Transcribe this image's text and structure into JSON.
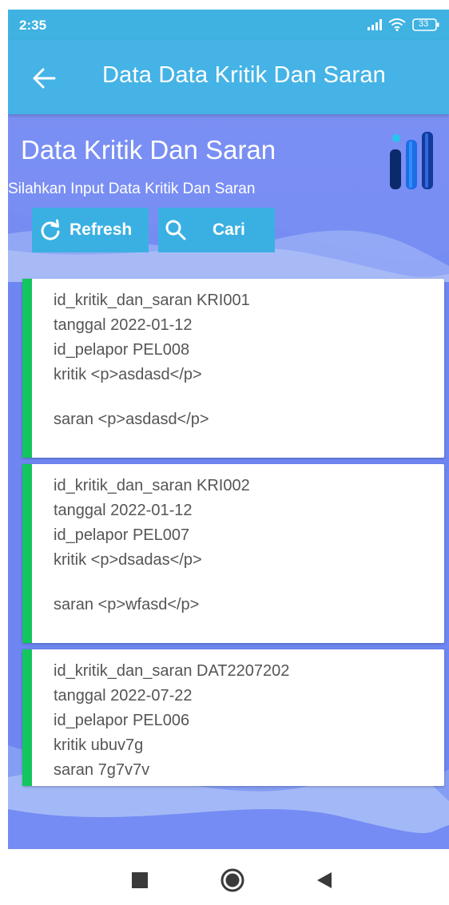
{
  "status_bar": {
    "time": "2:35",
    "battery": "33",
    "icons": [
      "signal-icon",
      "wifi-icon",
      "battery-icon"
    ]
  },
  "app_bar": {
    "title": "Data Data Kritik Dan Saran",
    "back_icon": "arrow-left-icon"
  },
  "header": {
    "title": "Data Kritik Dan Saran",
    "subtitle": "Silahkan Input Data Kritik Dan Saran",
    "logo_icon": "bar-chart-logo-icon"
  },
  "actions": {
    "refresh_label": "Refresh",
    "refresh_icon": "refresh-icon",
    "search_label": "Cari",
    "search_icon": "search-icon"
  },
  "records": [
    {
      "id_line": "id_kritik_dan_saran KRI001",
      "tanggal_line": "tanggal 2022-01-12",
      "pelapor_line": "id_pelapor PEL008",
      "kritik_line": "kritik <p>asdasd</p>",
      "saran_line": "saran <p>asdasd</p>"
    },
    {
      "id_line": "id_kritik_dan_saran KRI002",
      "tanggal_line": "tanggal 2022-01-12",
      "pelapor_line": "id_pelapor PEL007",
      "kritik_line": "kritik <p>dsadas</p>",
      "saran_line": "saran <p>wfasd</p>"
    },
    {
      "id_line": "id_kritik_dan_saran DAT2207202",
      "tanggal_line": "tanggal 2022-07-22",
      "pelapor_line": "id_pelapor PEL006",
      "kritik_line": "kritik ubuv7g",
      "saran_line": "saran 7g7v7v"
    }
  ],
  "nav_bar": {
    "icons": [
      "recents-square-icon",
      "home-circle-icon",
      "back-triangle-icon"
    ]
  },
  "colors": {
    "app_bar": "#45b3e6",
    "background": "#6d86f2",
    "button": "#3ab0e2",
    "card_accent": "#13c55e"
  }
}
